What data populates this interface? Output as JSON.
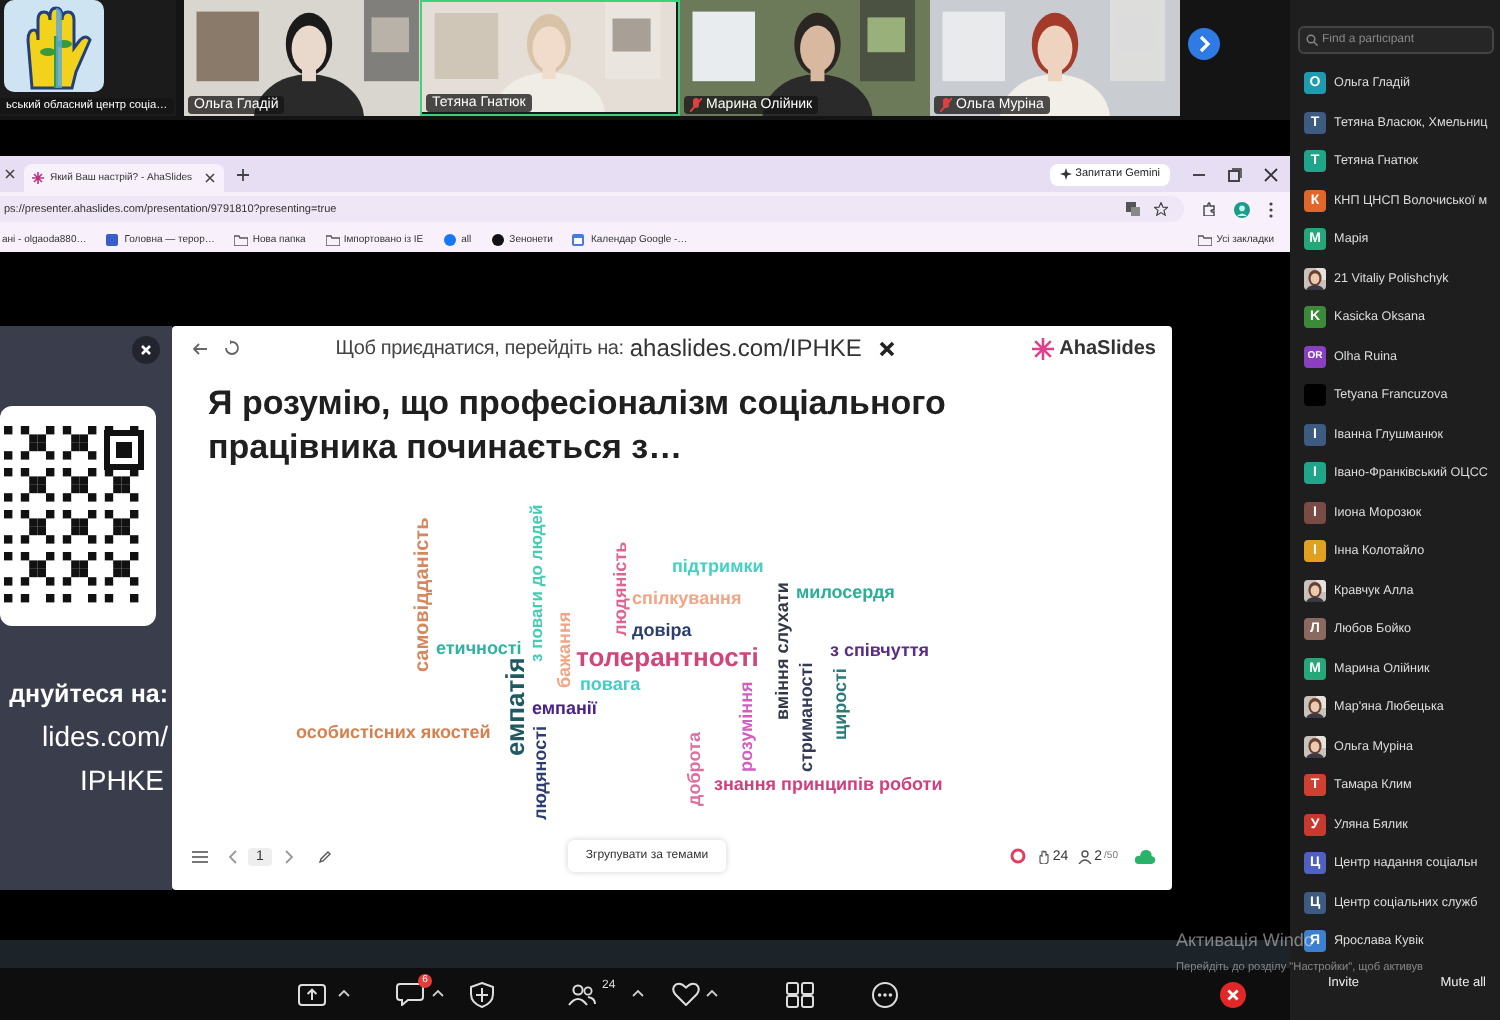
{
  "video_strip": {
    "tiles": [
      {
        "kind": "logo",
        "name": "ьський обласний центр соціа…",
        "speaking": false,
        "muted": false
      },
      {
        "kind": "picture",
        "name": "Ольга Гладій",
        "speaking": false,
        "muted": false
      },
      {
        "kind": "picture",
        "name": "Тетяна Гнатюк",
        "speaking": true,
        "muted": false
      },
      {
        "kind": "picture",
        "name": "Марина Олійник",
        "speaking": false,
        "muted": true
      },
      {
        "kind": "picture",
        "name": "Ольга Муріна",
        "speaking": false,
        "muted": true
      }
    ]
  },
  "browser": {
    "tabs": [
      {
        "title": "Який Ваш настрій? - AhaSlides",
        "selected": true
      }
    ],
    "gemini_button": "Запитати Gemini",
    "address": "ps://presenter.ahaslides.com/presentation/9791810?presenting=true",
    "bookmarks": [
      {
        "kind": "page",
        "label": "ані - olgaoda880…"
      },
      {
        "kind": "page",
        "label": "Головна — терор…"
      },
      {
        "kind": "folder",
        "label": "Нова папка"
      },
      {
        "kind": "folder",
        "label": "Імпортовано із IE"
      },
      {
        "kind": "facebook",
        "label": "all"
      },
      {
        "kind": "circle",
        "label": "Зенонети"
      },
      {
        "kind": "calendar",
        "label": "Календар Google -…"
      }
    ],
    "all_bookmarks": "Усі закладки"
  },
  "slide": {
    "join_panel": {
      "lines": [
        "днуйтеся на:",
        "lides.com/",
        "IPHKE"
      ]
    },
    "join_bar": {
      "label": "Щоб приєднатися, перейдіть на:",
      "link": "ahaslides.com/IPHKE"
    },
    "brand": "AhaSlides",
    "title": "Я розумію, що професіоналізм соціального працівника починається з…",
    "words": [
      {
        "text": "самовідданість",
        "color": "#d5875e",
        "kind": "vertical"
      },
      {
        "text": "з поваги до людей",
        "color": "#45cdb4",
        "kind": "vertical"
      },
      {
        "text": "етичності",
        "color": "#2fb3a0",
        "kind": "horizontal"
      },
      {
        "text": "бажання",
        "color": "#f0a585",
        "kind": "vertical"
      },
      {
        "text": "людяність",
        "color": "#e0648f",
        "kind": "vertical"
      },
      {
        "text": "підтримки",
        "color": "#45d0c4",
        "kind": "horizontal"
      },
      {
        "text": "спілкування",
        "color": "#f0a585",
        "kind": "horizontal"
      },
      {
        "text": "милосердя",
        "color": "#2aae96",
        "kind": "horizontal"
      },
      {
        "text": "довіра",
        "color": "#2c3d6e",
        "kind": "horizontal"
      },
      {
        "text": "толерантності",
        "color": "#d0457a",
        "kind": "horizontal"
      },
      {
        "text": "вміння слухати",
        "color": "#333844",
        "kind": "vertical"
      },
      {
        "text": "з співчуття",
        "color": "#5a2d84",
        "kind": "horizontal"
      },
      {
        "text": "повага",
        "color": "#45cdc4",
        "kind": "horizontal"
      },
      {
        "text": "емпатія",
        "color": "#1f5a62",
        "kind": "vertical"
      },
      {
        "text": "емпанії",
        "color": "#4a2285",
        "kind": "horizontal"
      },
      {
        "text": "особистісних якостей",
        "color": "#d5804f",
        "kind": "horizontal"
      },
      {
        "text": "людяності",
        "color": "#2c3d6e",
        "kind": "vertical"
      },
      {
        "text": "доброта",
        "color": "#e06fa0",
        "kind": "vertical"
      },
      {
        "text": "розуміння",
        "color": "#d35cc0",
        "kind": "vertical"
      },
      {
        "text": "стриманості",
        "color": "#333a55",
        "kind": "vertical"
      },
      {
        "text": "щирості",
        "color": "#2a7a7a",
        "kind": "vertical"
      },
      {
        "text": "знання принципів роботи",
        "color": "#d0407e",
        "kind": "horizontal"
      }
    ],
    "footer": {
      "page": "1",
      "group_button": "Згрупувати за темами",
      "reactions": "24",
      "participants": "2",
      "limit": "/50"
    }
  },
  "toolbar": {
    "chat_badge": "6",
    "participants_count": "24"
  },
  "participants_panel": {
    "search": {
      "placeholder": "Find a participant"
    },
    "participants": [
      {
        "kind": "letter",
        "initial": "О",
        "color": "#1e9bb0",
        "name": "Ольга Гладій"
      },
      {
        "kind": "letter",
        "initial": "Т",
        "color": "#3d5a80",
        "name": "Тетяна Власюк, Хмельниц"
      },
      {
        "kind": "letter",
        "initial": "Т",
        "color": "#1fa58a",
        "name": "Тетяна Гнатюк"
      },
      {
        "kind": "letter",
        "initial": "К",
        "color": "#e0662a",
        "name": "КНП ЦНСП Волочиської м"
      },
      {
        "kind": "letter",
        "initial": "М",
        "color": "#25a77a",
        "name": "Марія"
      },
      {
        "name": "21 Vitaliy Polishchyk"
      },
      {
        "kind": "letter",
        "initial": "K",
        "color": "#3a8a3a",
        "name": "Kasicka Oksana"
      },
      {
        "kind": "letter",
        "initial": "OR",
        "color": "#8a3fc0",
        "name": "Olha Ruina"
      },
      {
        "kind": "plain",
        "color": "#000000",
        "name": "Tetyana Francuzova"
      },
      {
        "kind": "letter",
        "initial": "І",
        "color": "#3d5a80",
        "name": "Іванна Глушманюк"
      },
      {
        "kind": "letter",
        "initial": "І",
        "color": "#1fa58a",
        "name": "Івано-Франківський ОЦСС"
      },
      {
        "kind": "letter",
        "initial": "І",
        "color": "#7a4a44",
        "name": "Іиона Морозюк"
      },
      {
        "kind": "letter",
        "initial": "І",
        "color": "#e0a020",
        "name": "Інна Колотайло"
      },
      {
        "name": "Кравчук Алла"
      },
      {
        "kind": "letter",
        "initial": "Л",
        "color": "#8a6a60",
        "name": "Любов Бойко"
      },
      {
        "kind": "letter",
        "initial": "М",
        "color": "#25a77a",
        "name": "Марина Олійник"
      },
      {
        "name": "Мар'яна Любецька"
      },
      {
        "name": "Ольга Муріна"
      },
      {
        "kind": "letter",
        "initial": "Т",
        "color": "#d04030",
        "name": "Тамара Клим"
      },
      {
        "kind": "letter",
        "initial": "У",
        "color": "#c83a30",
        "name": "Уляна Бялик"
      },
      {
        "kind": "letter",
        "initial": "Ц",
        "color": "#5060c0",
        "name": "Центр надання соціальн"
      },
      {
        "kind": "letter",
        "initial": "Ц",
        "color": "#3d5a80",
        "name": "Центр соціальних служб"
      },
      {
        "kind": "letter",
        "initial": "Я",
        "color": "#3d80d0",
        "name": "Ярослава Кувік"
      }
    ],
    "buttons": [
      "Invite",
      "Mute all"
    ]
  },
  "system_notice": {
    "title": "Активація Windo",
    "text": "Перейдіть до розділу \"Настройки\", щоб активув"
  }
}
